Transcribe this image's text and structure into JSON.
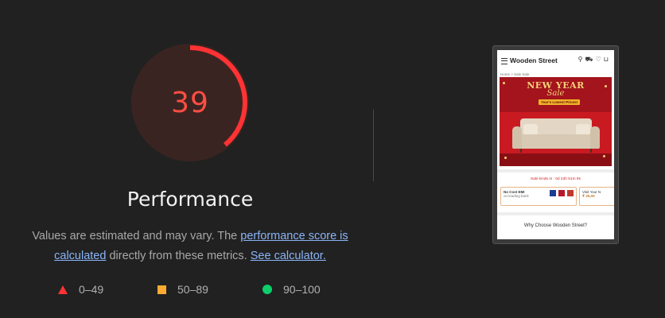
{
  "gauge": {
    "score": "39",
    "fraction": 0.39,
    "color": "#ff4e42"
  },
  "title": "Performance",
  "description": {
    "text1": "Values are estimated and may vary. The ",
    "link1": "performance score is calculated",
    "text2": " directly from these metrics. ",
    "link2": "See calculator."
  },
  "legend": [
    {
      "icon": "triangle-icon",
      "range": "0–49",
      "color": "#ff3333"
    },
    {
      "icon": "square-icon",
      "range": "50–89",
      "color": "#ffaa33"
    },
    {
      "icon": "circle-icon",
      "range": "90–100",
      "color": "#0cce6b"
    }
  ],
  "screenshot": {
    "logo": "Wooden Street",
    "breadcrumb": "Home > Sale Sale",
    "banner_title": "NEW YEAR",
    "banner_script": "Sale",
    "banner_pill": "Year's Lowest Prices!",
    "timer": "Sale Ends In :  0d  22h  51m  9s",
    "offer1_line1": "No Cost EMI",
    "offer1_line2": "on leading bank",
    "offer2_line1": "Visit Your N",
    "offer2_line2": "₹ 25,00",
    "why": "Why Choose Wooden Street?"
  }
}
